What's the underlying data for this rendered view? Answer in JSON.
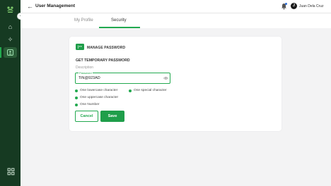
{
  "header": {
    "title": "User Management",
    "user_initial": "J",
    "user_name": "Juan Dela Cruz"
  },
  "tabs": [
    {
      "label": "My Profile",
      "active": false
    },
    {
      "label": "Security",
      "active": true
    }
  ],
  "card": {
    "title": "MANAGE PASSWORD",
    "icon_text": "|**",
    "section_title": "GET TEMPORARY PASSWORD",
    "description": "Description",
    "password_field": {
      "label": "Password",
      "value": "TiN@923AD"
    },
    "requirements": [
      "One lowercase character",
      "One special character",
      "One uppercase character",
      "One Number"
    ],
    "cancel_label": "Cancel",
    "save_label": "Save"
  },
  "colors": {
    "primary_green": "#1f9e4a",
    "sidebar_bg": "#163a22",
    "notification_dot": "#2f6fd6"
  },
  "icons": {
    "sidebar": [
      "logo-icon",
      "home-icon",
      "settings-icon",
      "user-security-icon",
      "apps-grid-icon"
    ],
    "top": [
      "back-arrow-icon",
      "bell-icon"
    ],
    "field": [
      "eye-icon"
    ]
  }
}
